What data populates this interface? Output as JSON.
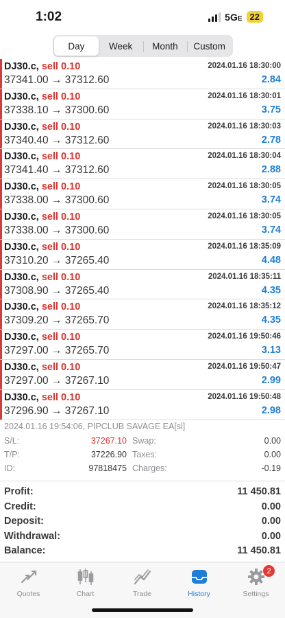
{
  "status": {
    "time": "1:02",
    "network": "5G",
    "network_suffix": "E",
    "battery": "22"
  },
  "period_tabs": [
    "Day",
    "Week",
    "Month",
    "Custom"
  ],
  "selected_period": "Day",
  "deals": [
    {
      "symbol": "DJ30.c,",
      "side": "sell 0.10",
      "time": "2024.01.16 18:30:00",
      "prices": "37341.00 → 37312.60",
      "profit": "2.84"
    },
    {
      "symbol": "DJ30.c,",
      "side": "sell 0.10",
      "time": "2024.01.16 18:30:01",
      "prices": "37338.10 → 37300.60",
      "profit": "3.75"
    },
    {
      "symbol": "DJ30.c,",
      "side": "sell 0.10",
      "time": "2024.01.16 18:30:03",
      "prices": "37340.40 → 37312.60",
      "profit": "2.78"
    },
    {
      "symbol": "DJ30.c,",
      "side": "sell 0.10",
      "time": "2024.01.16 18:30:04",
      "prices": "37341.40 → 37312.60",
      "profit": "2.88"
    },
    {
      "symbol": "DJ30.c,",
      "side": "sell 0.10",
      "time": "2024.01.16 18:30:05",
      "prices": "37338.00 → 37300.60",
      "profit": "3.74"
    },
    {
      "symbol": "DJ30.c,",
      "side": "sell 0.10",
      "time": "2024.01.16 18:30:05",
      "prices": "37338.00 → 37300.60",
      "profit": "3.74"
    },
    {
      "symbol": "DJ30.c,",
      "side": "sell 0.10",
      "time": "2024.01.16 18:35:09",
      "prices": "37310.20 → 37265.40",
      "profit": "4.48"
    },
    {
      "symbol": "DJ30.c,",
      "side": "sell 0.10",
      "time": "2024.01.16 18:35:11",
      "prices": "37308.90 → 37265.40",
      "profit": "4.35"
    },
    {
      "symbol": "DJ30.c,",
      "side": "sell 0.10",
      "time": "2024.01.16 18:35:12",
      "prices": "37309.20 → 37265.70",
      "profit": "4.35"
    },
    {
      "symbol": "DJ30.c,",
      "side": "sell 0.10",
      "time": "2024.01.16 19:50:46",
      "prices": "37297.00 → 37265.70",
      "profit": "3.13"
    },
    {
      "symbol": "DJ30.c,",
      "side": "sell 0.10",
      "time": "2024.01.16 19:50:47",
      "prices": "37297.00 → 37267.10",
      "profit": "2.99"
    },
    {
      "symbol": "DJ30.c,",
      "side": "sell 0.10",
      "time": "2024.01.16 19:50:48",
      "prices": "37296.90 → 37267.10",
      "profit": "2.98"
    }
  ],
  "detail": {
    "header": "2024.01.16 19:54:06, PIPCLUB SAVAGE EA[sl]",
    "sl_label": "S/L:",
    "sl_value": "37267.10",
    "tp_label": "T/P:",
    "tp_value": "37226.90",
    "id_label": "ID:",
    "id_value": "97818475",
    "swap_label": "Swap:",
    "swap_value": "0.00",
    "taxes_label": "Taxes:",
    "taxes_value": "0.00",
    "charges_label": "Charges:",
    "charges_value": "-0.19"
  },
  "summary": [
    {
      "label": "Profit:",
      "value": "11 450.81"
    },
    {
      "label": "Credit:",
      "value": "0.00"
    },
    {
      "label": "Deposit:",
      "value": "0.00"
    },
    {
      "label": "Withdrawal:",
      "value": "0.00"
    },
    {
      "label": "Balance:",
      "value": "11 450.81"
    }
  ],
  "tabbar": {
    "quotes": "Quotes",
    "chart": "Chart",
    "trade": "Trade",
    "history": "History",
    "settings": "Settings",
    "settings_badge": "2",
    "active": "History"
  },
  "colors": {
    "sell": "#d9352f",
    "profit": "#1f7ed8",
    "accent": "#1f7ed8",
    "row_marker": "#d93a3a"
  }
}
